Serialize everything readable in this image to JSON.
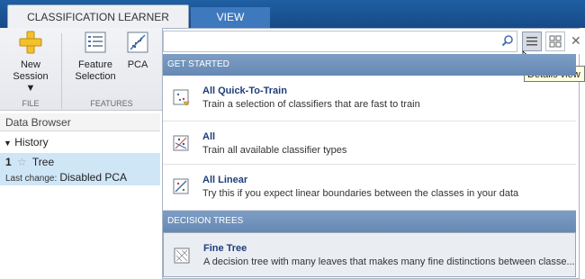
{
  "tabs": {
    "active": "CLASSIFICATION LEARNER",
    "inactive": "VIEW"
  },
  "toolstrip": {
    "new_session_line1": "New",
    "new_session_line2": "Session ▼",
    "feature_selection_line1": "Feature",
    "feature_selection_line2": "Selection",
    "pca": "PCA",
    "section_file": "FILE",
    "section_features": "FEATURES"
  },
  "left_panel": {
    "data_browser": "Data Browser",
    "history": "History",
    "model_number": "1",
    "model_name": "Tree",
    "last_change_label": "Last change:",
    "last_change_value": "Disabled PCA"
  },
  "gallery": {
    "search_value": "",
    "sections": {
      "get_started": "GET STARTED",
      "decision_trees": "DECISION TREES"
    },
    "items": [
      {
        "title": "All Quick-To-Train",
        "desc": "Train a selection of classifiers that are fast to train"
      },
      {
        "title": "All",
        "desc": "Train all available classifier types"
      },
      {
        "title": "All Linear",
        "desc": "Try this if you expect linear boundaries between the classes in your data"
      },
      {
        "title": "Fine Tree",
        "desc": "A decision tree with many leaves that makes many fine distinctions between classe..."
      }
    ],
    "tooltip": "Details view"
  }
}
